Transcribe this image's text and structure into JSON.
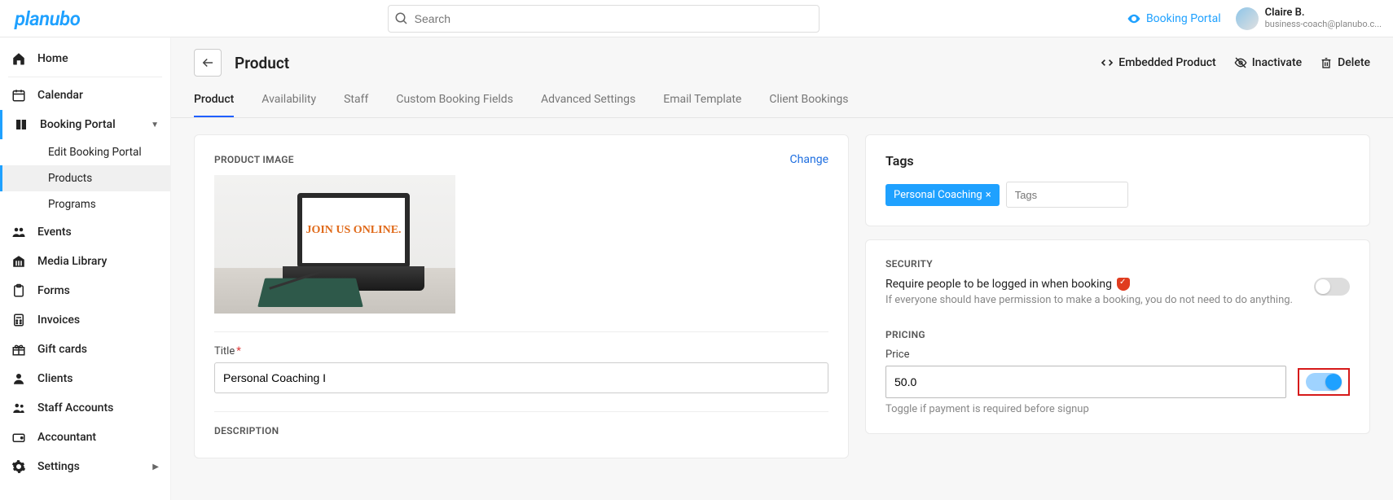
{
  "brand": "planubo",
  "search": {
    "placeholder": "Search"
  },
  "top": {
    "booking_portal": "Booking Portal",
    "user_name": "Claire B.",
    "user_email": "business-coach@planubo.c..."
  },
  "sidebar": {
    "home": "Home",
    "calendar": "Calendar",
    "booking_portal": "Booking Portal",
    "sub_edit": "Edit Booking Portal",
    "sub_products": "Products",
    "sub_programs": "Programs",
    "events": "Events",
    "media_library": "Media Library",
    "forms": "Forms",
    "invoices": "Invoices",
    "gift_cards": "Gift cards",
    "clients": "Clients",
    "staff": "Staff Accounts",
    "accountant": "Accountant",
    "settings": "Settings"
  },
  "page": {
    "title": "Product",
    "embedded": "Embedded Product",
    "inactivate": "Inactivate",
    "delete": "Delete"
  },
  "tabs": {
    "product": "Product",
    "availability": "Availability",
    "staff": "Staff",
    "custom": "Custom Booking Fields",
    "advanced": "Advanced Settings",
    "email": "Email Template",
    "client": "Client Bookings"
  },
  "product": {
    "image_label": "PRODUCT IMAGE",
    "change": "Change",
    "img_text": "JOIN US ONLINE.",
    "title_label": "Title",
    "title_value": "Personal Coaching I",
    "desc_label": "DESCRIPTION"
  },
  "tags": {
    "heading": "Tags",
    "chip": "Personal Coaching",
    "placeholder": "Tags"
  },
  "security": {
    "heading": "SECURITY",
    "main": "Require people to be logged in when booking",
    "sub": "If everyone should have permission to make a booking, you do not need to do anything."
  },
  "pricing": {
    "heading": "PRICING",
    "price_label": "Price",
    "price_value": "50.0",
    "help": "Toggle if payment is required before signup"
  }
}
